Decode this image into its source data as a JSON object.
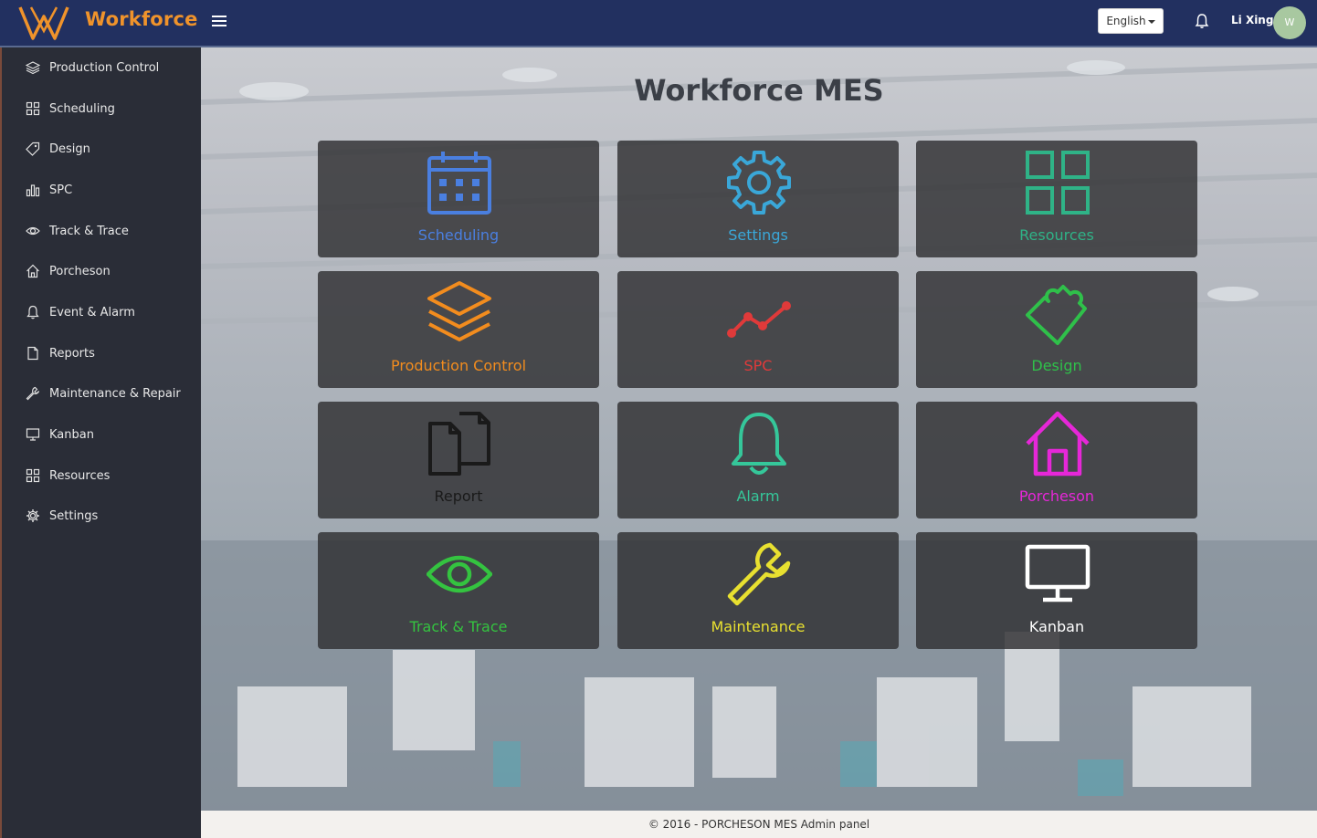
{
  "header": {
    "brand": "Workforce",
    "language": "English",
    "username": "Li Xing",
    "avatar_initials": "W"
  },
  "sidebar": {
    "items": [
      {
        "label": "Production Control",
        "icon": "layers-icon"
      },
      {
        "label": "Scheduling",
        "icon": "grid-icon"
      },
      {
        "label": "Design",
        "icon": "tag-icon"
      },
      {
        "label": "SPC",
        "icon": "bar-chart-icon"
      },
      {
        "label": "Track & Trace",
        "icon": "eye-icon"
      },
      {
        "label": "Porcheson",
        "icon": "home-icon"
      },
      {
        "label": "Event & Alarm",
        "icon": "bell-icon"
      },
      {
        "label": "Reports",
        "icon": "document-icon"
      },
      {
        "label": "Maintenance & Repair",
        "icon": "wrench-icon"
      },
      {
        "label": "Kanban",
        "icon": "monitor-icon"
      },
      {
        "label": "Resources",
        "icon": "grid-icon"
      },
      {
        "label": "Settings",
        "icon": "gear-icon"
      }
    ]
  },
  "main": {
    "title": "Workforce MES",
    "tiles": [
      {
        "label": "Scheduling",
        "icon": "calendar-icon",
        "color": "#4a7fe0"
      },
      {
        "label": "Settings",
        "icon": "gear-icon",
        "color": "#3aa7d8"
      },
      {
        "label": "Resources",
        "icon": "grid-icon",
        "color": "#2fb387"
      },
      {
        "label": "Production Control",
        "icon": "layers-icon",
        "color": "#f28c1e"
      },
      {
        "label": "SPC",
        "icon": "line-chart-icon",
        "color": "#e03a3a"
      },
      {
        "label": "Design",
        "icon": "puzzle-icon",
        "color": "#2fc04a"
      },
      {
        "label": "Report",
        "icon": "documents-icon",
        "color": "#1a1a1a"
      },
      {
        "label": "Alarm",
        "icon": "bell-icon",
        "color": "#35c79a"
      },
      {
        "label": "Porcheson",
        "icon": "house-icon",
        "color": "#e627d8"
      },
      {
        "label": "Track & Trace",
        "icon": "eye-icon",
        "color": "#34c340"
      },
      {
        "label": "Maintenance",
        "icon": "wrench-icon",
        "color": "#e8e030"
      },
      {
        "label": "Kanban",
        "icon": "monitor-icon",
        "color": "#ffffff"
      }
    ]
  },
  "footer": {
    "text": "© 2016 - PORCHESON MES Admin panel"
  }
}
